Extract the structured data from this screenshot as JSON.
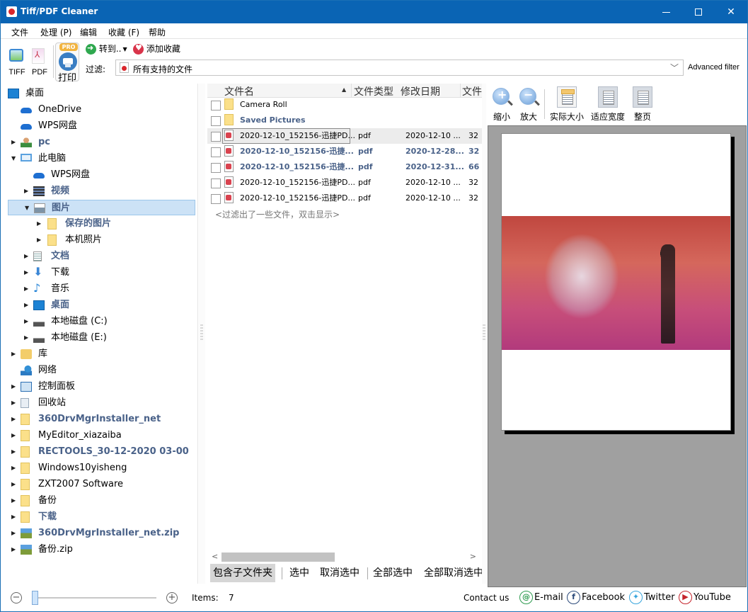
{
  "window": {
    "title": "Tiff/PDF Cleaner",
    "minimize_label": "",
    "maximize_label": "",
    "close_label": "✕"
  },
  "menu": [
    "文件",
    "处理 (P)",
    "编辑",
    "收藏 (F)",
    "帮助"
  ],
  "toolbar": {
    "tiff_label": "TIFF",
    "pdf_label": "PDF",
    "print_label": "打印",
    "print_badge": "PRO",
    "goto_label": "转到..",
    "favorite_label": "添加收藏",
    "filter_label": "过滤:",
    "filter_value": "所有支持的文件",
    "advanced_filter_label": "Advanced filter"
  },
  "tree": [
    {
      "label": "桌面",
      "icon": "desktop-icon",
      "level": 0,
      "arrow": "",
      "bold": false
    },
    {
      "label": "OneDrive",
      "icon": "cloud-icon",
      "level": 1,
      "arrow": "",
      "bold": false
    },
    {
      "label": "WPS网盘",
      "icon": "cloud-icon",
      "level": 1,
      "arrow": "",
      "bold": false
    },
    {
      "label": "pc",
      "icon": "user-icon",
      "level": 1,
      "arrow": "▶",
      "bold": true
    },
    {
      "label": "此电脑",
      "icon": "computer-icon",
      "level": 1,
      "arrow": "▼",
      "bold": false
    },
    {
      "label": "WPS网盘",
      "icon": "cloud-icon",
      "level": 2,
      "arrow": "",
      "bold": false
    },
    {
      "label": "视频",
      "icon": "video-icon",
      "level": 2,
      "arrow": "▶",
      "bold": true
    },
    {
      "label": "图片",
      "icon": "picture-icon",
      "level": 2,
      "arrow": "▼",
      "bold": true,
      "selected": true
    },
    {
      "label": "保存的图片",
      "icon": "folder-icon",
      "level": 3,
      "arrow": "▶",
      "bold": true
    },
    {
      "label": "本机照片",
      "icon": "folder-icon",
      "level": 3,
      "arrow": "▶",
      "bold": false
    },
    {
      "label": "文档",
      "icon": "document-icon",
      "level": 2,
      "arrow": "▶",
      "bold": true
    },
    {
      "label": "下载",
      "icon": "download-icon",
      "level": 2,
      "arrow": "▶",
      "bold": false
    },
    {
      "label": "音乐",
      "icon": "music-icon",
      "level": 2,
      "arrow": "▶",
      "bold": false
    },
    {
      "label": "桌面",
      "icon": "desktop-icon",
      "level": 2,
      "arrow": "▶",
      "bold": true
    },
    {
      "label": "本地磁盘 (C:)",
      "icon": "drive-icon",
      "level": 2,
      "arrow": "▶",
      "bold": false
    },
    {
      "label": "本地磁盘 (E:)",
      "icon": "drive-icon",
      "level": 2,
      "arrow": "▶",
      "bold": false
    },
    {
      "label": "库",
      "icon": "library-icon",
      "level": 1,
      "arrow": "▶",
      "bold": false
    },
    {
      "label": "网络",
      "icon": "network-icon",
      "level": 1,
      "arrow": "",
      "bold": false
    },
    {
      "label": "控制面板",
      "icon": "control-panel-icon",
      "level": 1,
      "arrow": "▶",
      "bold": false
    },
    {
      "label": "回收站",
      "icon": "recycle-bin-icon",
      "level": 1,
      "arrow": "▶",
      "bold": false
    },
    {
      "label": "360DrvMgrInstaller_net",
      "icon": "folder-icon",
      "level": 1,
      "arrow": "▶",
      "bold": true
    },
    {
      "label": "MyEditor_xiazaiba",
      "icon": "folder-icon",
      "level": 1,
      "arrow": "▶",
      "bold": false
    },
    {
      "label": "RECTOOLS_30-12-2020 03-00",
      "icon": "folder-icon",
      "level": 1,
      "arrow": "▶",
      "bold": true
    },
    {
      "label": "Windows10yisheng",
      "icon": "folder-icon",
      "level": 1,
      "arrow": "▶",
      "bold": false
    },
    {
      "label": "ZXT2007 Software",
      "icon": "folder-icon",
      "level": 1,
      "arrow": "▶",
      "bold": false
    },
    {
      "label": "备份",
      "icon": "folder-icon",
      "level": 1,
      "arrow": "▶",
      "bold": false
    },
    {
      "label": "下载",
      "icon": "folder-icon",
      "level": 1,
      "arrow": "▶",
      "bold": true
    },
    {
      "label": "360DrvMgrInstaller_net.zip",
      "icon": "zip-icon",
      "level": 1,
      "arrow": "▶",
      "bold": true
    },
    {
      "label": "备份.zip",
      "icon": "zip-icon",
      "level": 1,
      "arrow": "▶",
      "bold": false
    }
  ],
  "file_list": {
    "columns": [
      "文件名",
      "文件类型",
      "修改日期",
      "文件"
    ],
    "sort_indicator": "▲",
    "rows": [
      {
        "name": "Camera Roll",
        "type": "",
        "date": "",
        "size": "",
        "kind": "folder",
        "bold": false,
        "focused": false
      },
      {
        "name": "Saved Pictures",
        "type": "",
        "date": "",
        "size": "",
        "kind": "folder",
        "bold": true,
        "focused": false
      },
      {
        "name": "2020-12-10_152156-迅捷PD...",
        "type": "pdf",
        "date": "2020-12-10 ...",
        "size": "32",
        "kind": "pdf",
        "bold": false,
        "focused": true
      },
      {
        "name": "2020-12-10_152156-迅捷...",
        "type": "pdf",
        "date": "2020-12-28...",
        "size": "32",
        "kind": "pdf",
        "bold": true,
        "focused": false
      },
      {
        "name": "2020-12-10_152156-迅捷...",
        "type": "pdf",
        "date": "2020-12-31...",
        "size": "66",
        "kind": "pdf",
        "bold": true,
        "focused": false
      },
      {
        "name": "2020-12-10_152156-迅捷PD...",
        "type": "pdf",
        "date": "2020-12-10 ...",
        "size": "32",
        "kind": "pdf",
        "bold": false,
        "focused": false
      },
      {
        "name": "2020-12-10_152156-迅捷PD...",
        "type": "pdf",
        "date": "2020-12-10 ...",
        "size": "32",
        "kind": "pdf",
        "bold": false,
        "focused": false
      }
    ],
    "filtered_hint": "<过滤出了一些文件，双击显示>",
    "scroll_left": "<",
    "scroll_right": ">"
  },
  "selection_bar": {
    "include_subfolders": "包含子文件夹",
    "select": "选中",
    "deselect": "取消选中",
    "select_all": "全部选中",
    "deselect_all": "全部取消选中"
  },
  "preview": {
    "zoom_out": "缩小",
    "zoom_in": "放大",
    "actual_size": "实际大小",
    "fit_width": "适应宽度",
    "full_page": "整页"
  },
  "statusbar": {
    "zoom_minus": "−",
    "zoom_plus": "+",
    "zoom_level_fraction": 0.0,
    "items_label": "Items:",
    "items_count": "7",
    "contact_label": "Contact us",
    "email_label": "E-mail",
    "facebook_label": "Facebook",
    "twitter_label": "Twitter",
    "youtube_label": "YouTube"
  }
}
